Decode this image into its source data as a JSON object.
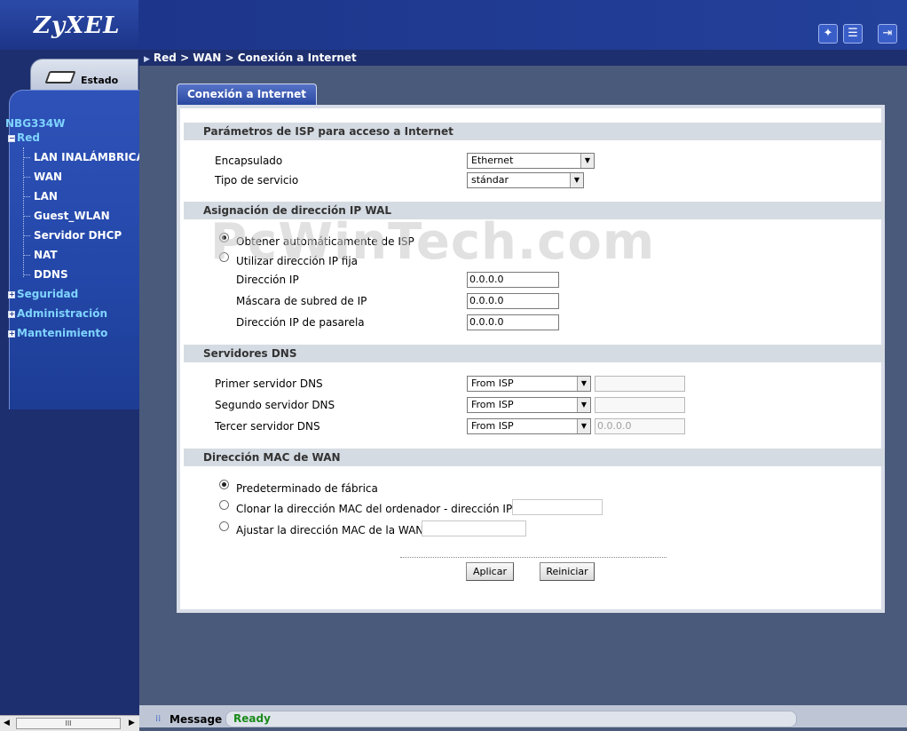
{
  "app": {
    "logo": "ZyXEL",
    "device": "NBG334W"
  },
  "header": {
    "breadcrumb": "Red > WAN > Conexión a Internet",
    "icons": [
      "wizard-icon",
      "notes-icon",
      "logout-icon"
    ]
  },
  "sidebar": {
    "status_tab": "Estado",
    "device": "NBG334W",
    "items": [
      {
        "label": "Red",
        "expanded": true
      },
      {
        "label": "LAN INALÁMBRICA"
      },
      {
        "label": "WAN"
      },
      {
        "label": "LAN"
      },
      {
        "label": "Guest_WLAN"
      },
      {
        "label": "Servidor DHCP"
      },
      {
        "label": "NAT"
      },
      {
        "label": "DDNS"
      },
      {
        "label": "Seguridad"
      },
      {
        "label": "Administración"
      },
      {
        "label": "Mantenimiento"
      }
    ],
    "scroll_thumb": "III"
  },
  "tab": {
    "label": "Conexión a Internet"
  },
  "isp": {
    "title": "Parámetros de ISP para acceso a Internet",
    "encap_label": "Encapsulado",
    "encap_value": "Ethernet",
    "service_label": "Tipo de servicio",
    "service_value": "stándar"
  },
  "ip": {
    "title": "Asignación de dirección IP WAL",
    "auto_label": "Obtener automáticamente de ISP",
    "fixed_label": "Utilizar dirección IP fija",
    "ip_label": "Dirección IP",
    "ip_value": "0.0.0.0",
    "mask_label": "Máscara de subred de IP",
    "mask_value": "0.0.0.0",
    "gw_label": "Dirección IP de pasarela",
    "gw_value": "0.0.0.0"
  },
  "dns": {
    "title": "Servidores DNS",
    "primary_label": "Primer servidor DNS",
    "primary_mode": "From ISP",
    "secondary_label": "Segundo servidor DNS",
    "secondary_mode": "From ISP",
    "tertiary_label": "Tercer servidor DNS",
    "tertiary_mode": "From ISP",
    "tertiary_value": "0.0.0.0"
  },
  "mac": {
    "title": "Dirección MAC de WAN",
    "default_label": "Predeterminado de fábrica",
    "clone_label": "Clonar la dirección MAC del ordenador - dirección IP",
    "set_label": "Ajustar la dirección MAC de la WAN"
  },
  "buttons": {
    "apply": "Aplicar",
    "reset": "Reiniciar"
  },
  "message": {
    "label": "Message",
    "status": "Ready"
  },
  "watermark": "PcWinTech.com"
}
